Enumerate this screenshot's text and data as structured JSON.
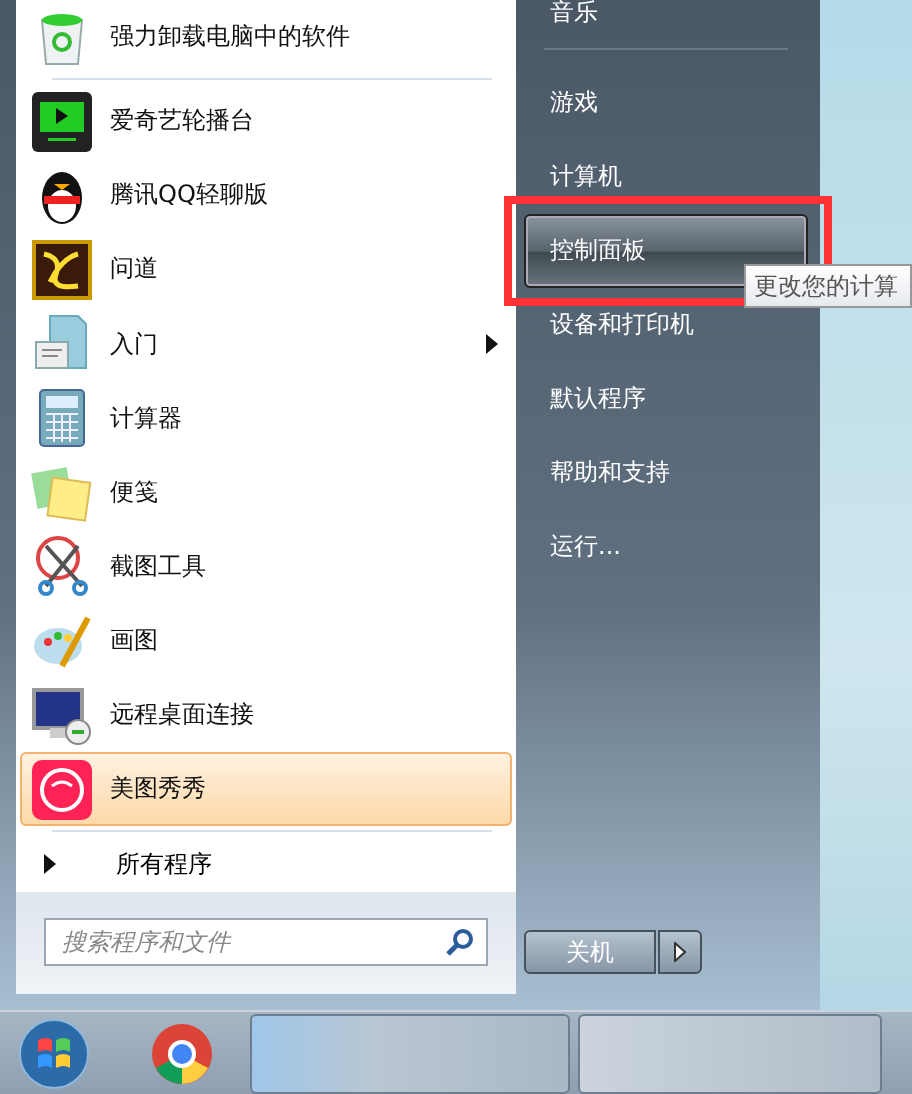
{
  "start_menu": {
    "pinned": [
      {
        "label": "强力卸载电脑中的软件",
        "selected": false,
        "has_submenu": false
      }
    ],
    "recent": [
      {
        "label": "爱奇艺轮播台",
        "selected": false,
        "has_submenu": false
      },
      {
        "label": "腾讯QQ轻聊版",
        "selected": false,
        "has_submenu": false
      },
      {
        "label": "问道",
        "selected": false,
        "has_submenu": false
      },
      {
        "label": "入门",
        "selected": false,
        "has_submenu": true
      },
      {
        "label": "计算器",
        "selected": false,
        "has_submenu": false
      },
      {
        "label": "便笺",
        "selected": false,
        "has_submenu": false
      },
      {
        "label": "截图工具",
        "selected": false,
        "has_submenu": false
      },
      {
        "label": "画图",
        "selected": false,
        "has_submenu": false
      },
      {
        "label": "远程桌面连接",
        "selected": false,
        "has_submenu": false
      },
      {
        "label": "美图秀秀",
        "selected": true,
        "has_submenu": false
      }
    ],
    "all_programs": "所有程序",
    "search": {
      "placeholder": "搜索程序和文件"
    },
    "places": [
      {
        "label": "音乐",
        "selected": false,
        "annotated": false,
        "separator_after": true
      },
      {
        "label": "游戏",
        "selected": false,
        "annotated": false,
        "separator_after": false
      },
      {
        "label": "计算机",
        "selected": false,
        "annotated": false,
        "separator_after": false
      },
      {
        "label": "控制面板",
        "selected": true,
        "annotated": true,
        "separator_after": false
      },
      {
        "label": "设备和打印机",
        "selected": false,
        "annotated": false,
        "separator_after": false
      },
      {
        "label": "默认程序",
        "selected": false,
        "annotated": false,
        "separator_after": false
      },
      {
        "label": "帮助和支持",
        "selected": false,
        "annotated": false,
        "separator_after": false
      },
      {
        "label": "运行...",
        "selected": false,
        "annotated": false,
        "separator_after": false
      }
    ],
    "shutdown": "关机"
  },
  "tooltip": "更改您的计算"
}
